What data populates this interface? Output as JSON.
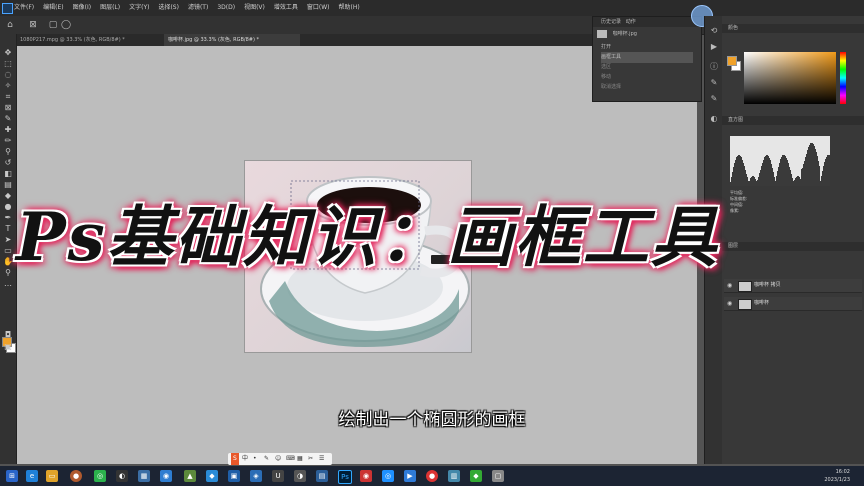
{
  "app": {
    "name": "Adobe Photoshop",
    "logo_icon": "ps-logo-icon"
  },
  "menubar": {
    "items": [
      "文件(F)",
      "编辑(E)",
      "图像(I)",
      "图层(L)",
      "文字(Y)",
      "选择(S)",
      "滤镜(T)",
      "3D(D)",
      "视图(V)",
      "增效工具",
      "窗口(W)",
      "帮助(H)"
    ]
  },
  "tabs": [
    {
      "label": "1080P217.mpg @ 33.3% (灰色, RGB/8#) *",
      "active": false
    },
    {
      "label": "咖啡杯.jpg @ 33.3% (灰色, RGB/8#) *",
      "active": true
    }
  ],
  "overlay": {
    "title": "Ps基础知识：画框工具",
    "subtitle": "绘制出一个椭圆形的画框"
  },
  "history_panel": {
    "tabs": [
      "历史记录",
      "动作"
    ],
    "header_item": "咖啡杯.jpg",
    "rows": [
      "打开",
      "画框工具",
      "选区",
      "移动",
      "取消选择"
    ]
  },
  "right_panel": {
    "color_tab": "颜色",
    "histogram_tab": "直方图",
    "histogram_stats": [
      "平均值:",
      "标准偏差:",
      "中间值:",
      "像素:"
    ],
    "layers_tab": "图层",
    "layers": [
      {
        "name": "咖啡杯 拷贝",
        "visible": true
      },
      {
        "name": "咖啡杯",
        "visible": true
      }
    ],
    "fg_color": "#f0a22a",
    "bg_color": "#ffffff"
  },
  "ime_bar": {
    "items": [
      "中",
      "•",
      "✎",
      "☺",
      "⌨",
      "▦",
      "✂",
      "☰"
    ]
  },
  "taskbar": {
    "tray_line1": "16:02",
    "tray_line2": "2023/1/23"
  },
  "colors": {
    "accent": "#e0245a",
    "menubar": "#2b2b2b",
    "canvas": "#bdbdbd"
  }
}
